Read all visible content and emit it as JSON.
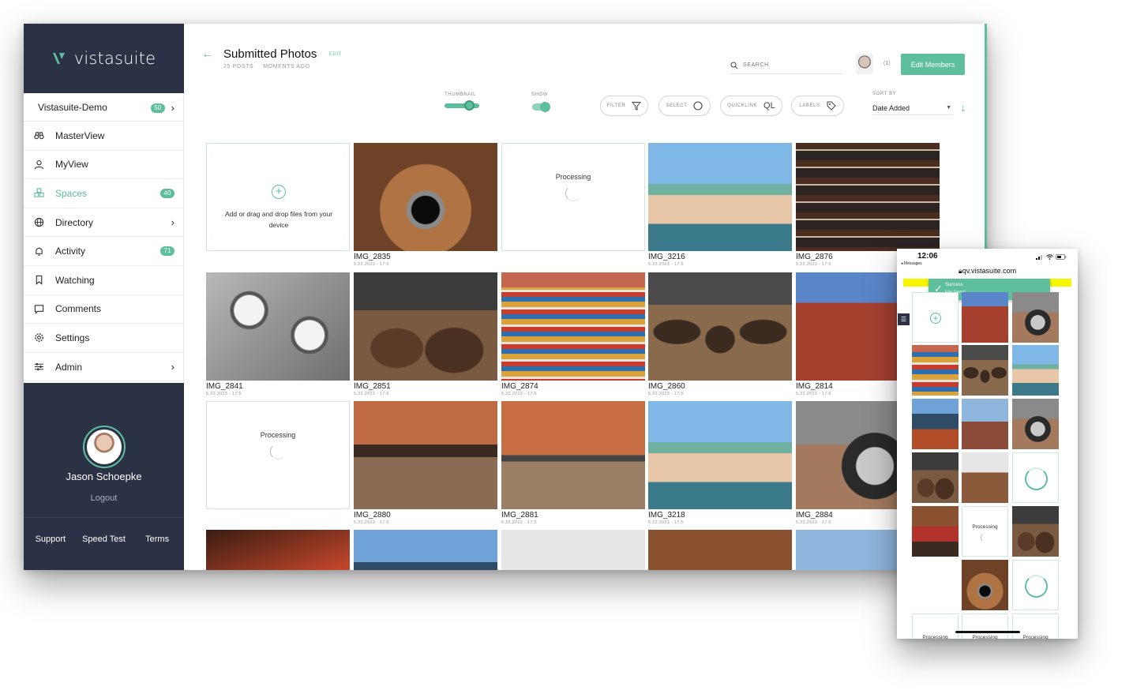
{
  "brand": {
    "name": "vistasuite",
    "accent": "#5dbf9c",
    "navy": "#2b3245"
  },
  "sidebar": {
    "org": {
      "label": "Vistasuite-Demo",
      "badge": "50"
    },
    "items": [
      {
        "label": "MasterView",
        "icon": "binoculars-icon"
      },
      {
        "label": "MyView",
        "icon": "user-icon"
      },
      {
        "label": "Spaces",
        "icon": "spaces-icon",
        "badge": "40",
        "active": true
      },
      {
        "label": "Directory",
        "icon": "globe-icon",
        "chevron": true
      },
      {
        "label": "Activity",
        "icon": "bell-icon",
        "badge": "71"
      },
      {
        "label": "Watching",
        "icon": "bookmark-icon"
      },
      {
        "label": "Comments",
        "icon": "comment-icon"
      },
      {
        "label": "Settings",
        "icon": "gear-icon"
      },
      {
        "label": "Admin",
        "icon": "sliders-icon",
        "chevron": true
      }
    ],
    "user": {
      "name": "Jason Schoepke",
      "logout": "Logout"
    },
    "footer": {
      "support": "Support",
      "speed_test": "Speed Test",
      "terms": "Terms"
    }
  },
  "header": {
    "title": "Submitted Photos",
    "edit": "EDIT",
    "posts": "25 POSTS",
    "updated": "MOMENTS AGO",
    "search_placeholder": "SEARCH",
    "member_count": "(1)",
    "edit_members": "Edit Members"
  },
  "toolbar": {
    "thumbnail_label": "THUMBNAIL",
    "show_label": "SHOW",
    "filter": "FILTER",
    "select": "SELECT",
    "quicklink": "QUICKLINK",
    "quicklink_glyph": "QL",
    "labels": "LABELS",
    "sort_by_label": "SORT BY",
    "sort_value": "Date Added"
  },
  "grid": {
    "add_text": "Add or drag and drop files from your device",
    "processing": "Processing",
    "tiles": [
      {
        "kind": "add"
      },
      {
        "kind": "photo",
        "name": "IMG_2835",
        "date": "5.22.2023 - 17:5"
      },
      {
        "kind": "processing"
      },
      {
        "kind": "photo",
        "name": "IMG_3216",
        "date": "5.22.2023 - 17:5"
      },
      {
        "kind": "photo",
        "name": "IMG_2876",
        "date": "5.22.2023 - 17:5"
      },
      {
        "kind": "photo",
        "name": "IMG_2841",
        "date": "5.22.2023 - 17:5"
      },
      {
        "kind": "photo",
        "name": "IMG_2851",
        "date": "5.22.2023 - 17:5"
      },
      {
        "kind": "photo",
        "name": "IMG_2874",
        "date": "5.22.2023 - 17:5"
      },
      {
        "kind": "photo",
        "name": "IMG_2860",
        "date": "5.22.2023 - 17:5"
      },
      {
        "kind": "photo",
        "name": "IMG_2814",
        "date": "5.22.2023 - 17:5"
      },
      {
        "kind": "processing"
      },
      {
        "kind": "photo",
        "name": "IMG_2880",
        "date": "5.22.2023 - 17:5"
      },
      {
        "kind": "photo",
        "name": "IMG_2881",
        "date": "5.22.2023 - 17:5"
      },
      {
        "kind": "photo",
        "name": "IMG_3218",
        "date": "5.22.2023 - 17:5"
      },
      {
        "kind": "photo",
        "name": "IMG_2884",
        "date": "5.22.2023 - 17:5"
      }
    ]
  },
  "phone": {
    "time": "12:06",
    "back": "◂ Messages",
    "url": "qv.vistasuite.com",
    "toast_title": "Success",
    "toast_msg": "File Saved.",
    "processing": "Processing"
  }
}
